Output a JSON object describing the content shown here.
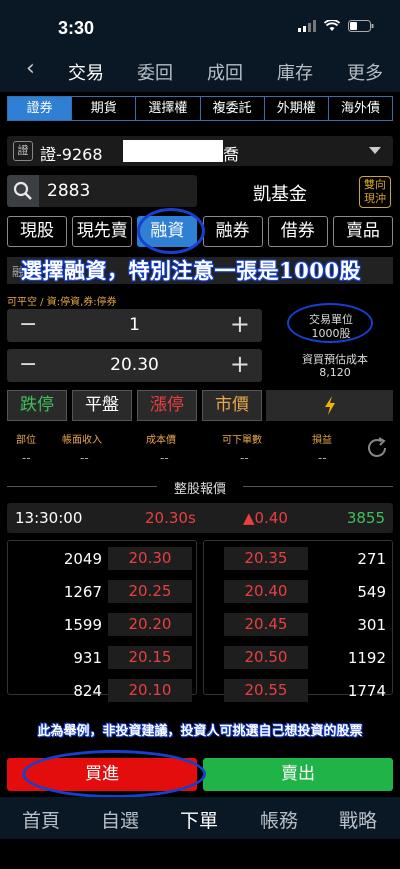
{
  "status": {
    "time": "3:30"
  },
  "nav": {
    "back": "‹",
    "tabs": [
      "交易",
      "委回",
      "成回",
      "庫存",
      "更多"
    ]
  },
  "product_tabs": [
    "證券",
    "期貨",
    "選擇權",
    "複委託",
    "外期權",
    "海外債"
  ],
  "account": {
    "badge": "證",
    "number": "證-9268",
    "tail": "喬"
  },
  "stock": {
    "code": "2883",
    "name": "凱基金",
    "swap_label_1": "雙向",
    "swap_label_2": "現沖"
  },
  "order_types": [
    "現股",
    "現先賣",
    "融資",
    "融券",
    "借券",
    "賣品"
  ],
  "annotation": "選擇融資，特別注意一張是1000股",
  "note_stub": "融",
  "hint": "可平空 / 資:停資,券:停券",
  "quantity": {
    "value": "1",
    "minus": "−",
    "plus": "+"
  },
  "price": {
    "value": "20.30",
    "minus": "−",
    "plus": "+"
  },
  "unit": {
    "label": "交易單位",
    "value": "1000股"
  },
  "estimate": {
    "label": "資買預估成本",
    "value": "8,120"
  },
  "price_buttons": {
    "limit_down": "跌停",
    "flat": "平盤",
    "limit_up": "漲停",
    "market": "市價"
  },
  "position": {
    "labels": [
      "部位",
      "帳面收入",
      "成本價",
      "可下單數",
      "損益"
    ],
    "values": [
      "--",
      "--",
      "--",
      "--",
      "--"
    ]
  },
  "section_title": "整股報價",
  "quote": {
    "time": "13:30:00",
    "price": "20.30s",
    "change": "▲0.40",
    "volume": "3855"
  },
  "bids": [
    {
      "qty": "2049",
      "price": "20.30"
    },
    {
      "qty": "1267",
      "price": "20.25"
    },
    {
      "qty": "1599",
      "price": "20.20"
    },
    {
      "qty": "931",
      "price": "20.15"
    },
    {
      "qty": "824",
      "price": "20.10"
    }
  ],
  "asks": [
    {
      "qty": "271",
      "price": "20.35"
    },
    {
      "qty": "549",
      "price": "20.40"
    },
    {
      "qty": "301",
      "price": "20.45"
    },
    {
      "qty": "1192",
      "price": "20.50"
    },
    {
      "qty": "1774",
      "price": "20.55"
    }
  ],
  "disclaimer": "此為舉例，非投資建議，投資人可挑選自己想投資的股票",
  "actions": {
    "buy": "買進",
    "sell": "賣出"
  },
  "bottom_tabs": [
    "首頁",
    "自選",
    "下單",
    "帳務",
    "戰略"
  ],
  "colors": {
    "accent": "#2f7fd4",
    "up": "#e84040",
    "down": "#3fc05a",
    "buy": "#e30d0d",
    "sell": "#1fb348",
    "highlight": "#1640d0"
  }
}
